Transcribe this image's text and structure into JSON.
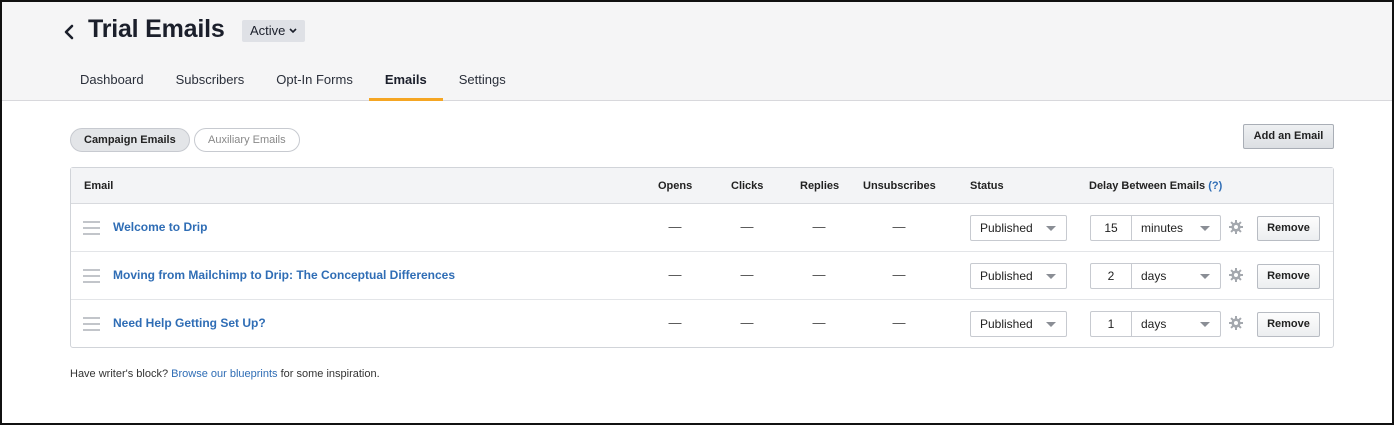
{
  "header": {
    "title": "Trial Emails",
    "status": "Active",
    "tabs": [
      "Dashboard",
      "Subscribers",
      "Opt-In Forms",
      "Emails",
      "Settings"
    ],
    "active_tab": "Emails"
  },
  "toggle": {
    "campaign": "Campaign Emails",
    "auxiliary": "Auxiliary Emails"
  },
  "add_email_label": "Add an Email",
  "table": {
    "columns": {
      "email": "Email",
      "opens": "Opens",
      "clicks": "Clicks",
      "replies": "Replies",
      "unsubscribes": "Unsubscribes",
      "status": "Status",
      "delay": "Delay Between Emails",
      "help": "(?)"
    },
    "rows": [
      {
        "name": "Welcome to Drip",
        "opens": "—",
        "clicks": "—",
        "replies": "—",
        "unsubscribes": "—",
        "status": "Published",
        "delay_value": "15",
        "delay_unit": "minutes",
        "remove": "Remove"
      },
      {
        "name": "Moving from Mailchimp to Drip: The Conceptual Differences",
        "opens": "—",
        "clicks": "—",
        "replies": "—",
        "unsubscribes": "—",
        "status": "Published",
        "delay_value": "2",
        "delay_unit": "days",
        "remove": "Remove"
      },
      {
        "name": "Need Help Getting Set Up?",
        "opens": "—",
        "clicks": "—",
        "replies": "—",
        "unsubscribes": "—",
        "status": "Published",
        "delay_value": "1",
        "delay_unit": "days",
        "remove": "Remove"
      }
    ]
  },
  "footer": {
    "prefix": "Have writer's block?",
    "link": "Browse our blueprints",
    "suffix": "for some inspiration."
  },
  "icons": {
    "back": "chevron-left-icon",
    "status_caret": "chevron-down-icon",
    "drag": "drag-handle-icon",
    "select_caret": "caret-down-icon",
    "settings": "gear-icon"
  },
  "colors": {
    "link": "#2f6db5",
    "active_tab_underline": "#f5a623",
    "header_bg": "#f5f5f6"
  }
}
